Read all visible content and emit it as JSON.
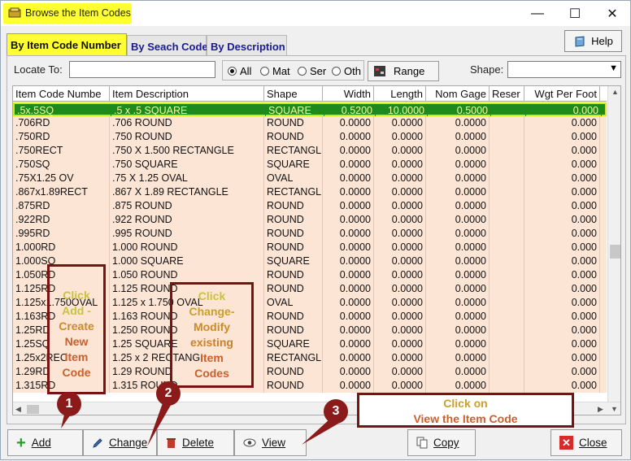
{
  "window": {
    "title": "Browse the Item Codes",
    "minimize": "—",
    "maximize": "☐",
    "close": "✕"
  },
  "tabs": [
    {
      "label": "By Item Code Number"
    },
    {
      "label": "By Seach Code"
    },
    {
      "label": "By Description"
    }
  ],
  "help": {
    "label": "Help"
  },
  "filters": {
    "locate_label": "Locate To:",
    "locate_value": "",
    "radios": [
      {
        "label": "All",
        "checked": true
      },
      {
        "label": "Mat",
        "checked": false
      },
      {
        "label": "Ser",
        "checked": false
      },
      {
        "label": "Oth",
        "checked": false
      }
    ],
    "range_label": "Range",
    "shape_label": "Shape:",
    "shape_value": ""
  },
  "grid": {
    "columns": [
      "Item Code Numbe",
      "Item Description",
      "Shape",
      "Width",
      "Length",
      "Nom Gage",
      "Reser",
      "Wgt Per Foot"
    ],
    "rows": [
      [
        ".5x.5SQ",
        ".5 x .5 SQUARE",
        "SQUARE",
        "0.5200",
        "10.0000",
        "0.5000",
        "",
        "0.000"
      ],
      [
        ".706RD",
        ".706 ROUND",
        "ROUND",
        "0.0000",
        "0.0000",
        "0.0000",
        "",
        "0.000"
      ],
      [
        ".750RD",
        ".750 ROUND",
        "ROUND",
        "0.0000",
        "0.0000",
        "0.0000",
        "",
        "0.000"
      ],
      [
        ".750RECT",
        ".750 X 1.500 RECTANGLE",
        "RECTANGLE",
        "0.0000",
        "0.0000",
        "0.0000",
        "",
        "0.000"
      ],
      [
        ".750SQ",
        ".750 SQUARE",
        "SQUARE",
        "0.0000",
        "0.0000",
        "0.0000",
        "",
        "0.000"
      ],
      [
        ".75X1.25 OV",
        ".75 X 1.25 OVAL",
        "OVAL",
        "0.0000",
        "0.0000",
        "0.0000",
        "",
        "0.000"
      ],
      [
        ".867x1.89RECT",
        ".867 X 1.89 RECTANGLE",
        "RECTANGLE",
        "0.0000",
        "0.0000",
        "0.0000",
        "",
        "0.000"
      ],
      [
        ".875RD",
        ".875 ROUND",
        "ROUND",
        "0.0000",
        "0.0000",
        "0.0000",
        "",
        "0.000"
      ],
      [
        ".922RD",
        ".922 ROUND",
        "ROUND",
        "0.0000",
        "0.0000",
        "0.0000",
        "",
        "0.000"
      ],
      [
        ".995RD",
        ".995 ROUND",
        "ROUND",
        "0.0000",
        "0.0000",
        "0.0000",
        "",
        "0.000"
      ],
      [
        "1.000RD",
        "1.000 ROUND",
        "ROUND",
        "0.0000",
        "0.0000",
        "0.0000",
        "",
        "0.000"
      ],
      [
        "1.000SQ",
        "1.000 SQUARE",
        "SQUARE",
        "0.0000",
        "0.0000",
        "0.0000",
        "",
        "0.000"
      ],
      [
        "1.050RD",
        "1.050 ROUND",
        "ROUND",
        "0.0000",
        "0.0000",
        "0.0000",
        "",
        "0.000"
      ],
      [
        "1.125RD",
        "1.125 ROUND",
        "ROUND",
        "0.0000",
        "0.0000",
        "0.0000",
        "",
        "0.000"
      ],
      [
        "1.125x1.750OVAL",
        "1.125 x 1.750 OVAL",
        "OVAL",
        "0.0000",
        "0.0000",
        "0.0000",
        "",
        "0.000"
      ],
      [
        "1.163RD",
        "1.163 ROUND",
        "ROUND",
        "0.0000",
        "0.0000",
        "0.0000",
        "",
        "0.000"
      ],
      [
        "1.25RD",
        "1.250 ROUND",
        "ROUND",
        "0.0000",
        "0.0000",
        "0.0000",
        "",
        "0.000"
      ],
      [
        "1.25SQ",
        "1.25 SQUARE",
        "SQUARE",
        "0.0000",
        "0.0000",
        "0.0000",
        "",
        "0.000"
      ],
      [
        "1.25x2REC",
        "1.25 x 2 RECTANG",
        "RECTANGLE",
        "0.0000",
        "0.0000",
        "0.0000",
        "",
        "0.000"
      ],
      [
        "1.29RD",
        "1.29 ROUND",
        "ROUND",
        "0.0000",
        "0.0000",
        "0.0000",
        "",
        "0.000"
      ],
      [
        "1.315RD",
        "1.315 ROUND",
        "ROUND",
        "0.0000",
        "0.0000",
        "0.0000",
        "",
        "0.000"
      ]
    ]
  },
  "buttons": {
    "add": "Add",
    "change": "Change",
    "delete": "Delete",
    "view": "View",
    "copy": "Copy",
    "close": "Close"
  },
  "callouts": {
    "add": [
      "Click",
      "Add -",
      "Create",
      "New",
      "Item",
      "Code"
    ],
    "change": [
      "Click",
      "Change-",
      "Modify",
      "existing",
      "Item",
      "Codes"
    ],
    "view": [
      "Click on",
      "View the Item Code"
    ]
  },
  "markers": [
    "1",
    "2",
    "3"
  ],
  "colors": {
    "highlight": "#ffff33",
    "selected_row": "#1e8a1e",
    "row_bg": "#fde5d6",
    "callout_border": "#7a1212"
  }
}
